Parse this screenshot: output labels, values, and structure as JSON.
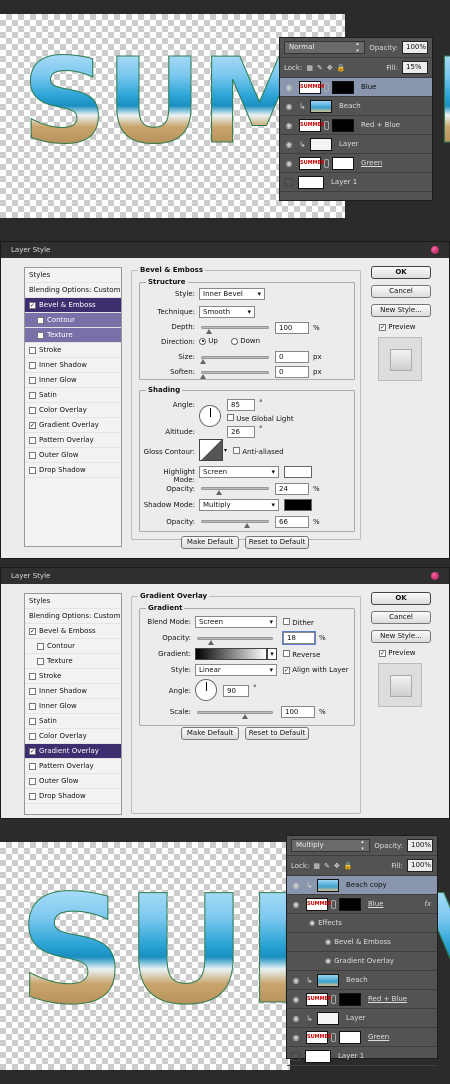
{
  "canvas1": {
    "word": "SUMME"
  },
  "layers1": {
    "blend_mode": "Normal",
    "opacity_label": "Opacity:",
    "opacity_value": "100%",
    "lock_label": "Lock:",
    "fill_label": "Fill:",
    "fill_value": "15%",
    "rows": [
      {
        "name": "Blue",
        "thumb": "SUMMER"
      },
      {
        "name": "Beach"
      },
      {
        "name": "Red + Blue",
        "thumb": "SUMMER"
      },
      {
        "name": "Layer"
      },
      {
        "name": "Green",
        "thumb": "SUMMER"
      },
      {
        "name": "Layer 1"
      }
    ]
  },
  "dialog1": {
    "title": "Layer Style",
    "styles_header": "Styles",
    "blending_options": "Blending Options: Custom",
    "style_items": [
      "Bevel & Emboss",
      "Contour",
      "Texture",
      "Stroke",
      "Inner Shadow",
      "Inner Glow",
      "Satin",
      "Color Overlay",
      "Gradient Overlay",
      "Pattern Overlay",
      "Outer Glow",
      "Drop Shadow"
    ],
    "section_title": "Bevel & Emboss",
    "structure": "Structure",
    "style_label": "Style:",
    "style_value": "Inner Bevel",
    "technique_label": "Technique:",
    "technique_value": "Smooth",
    "depth_label": "Depth:",
    "depth_value": "100",
    "pct": "%",
    "direction_label": "Direction:",
    "up": "Up",
    "down": "Down",
    "size_label": "Size:",
    "size_value": "0",
    "px": "px",
    "soften_label": "Soften:",
    "soften_value": "0",
    "shading": "Shading",
    "angle_label": "Angle:",
    "angle_value": "85",
    "deg": "°",
    "use_global_light": "Use Global Light",
    "altitude_label": "Altitude:",
    "altitude_value": "26",
    "gloss_label": "Gloss Contour:",
    "anti_aliased": "Anti-aliased",
    "highlight_label": "Highlight Mode:",
    "highlight_value": "Screen",
    "opacity_label": "Opacity:",
    "opacity1_value": "24",
    "shadow_label": "Shadow Mode:",
    "shadow_value": "Multiply",
    "opacity2_value": "66",
    "make_default": "Make Default",
    "reset_default": "Reset to Default",
    "ok": "OK",
    "cancel": "Cancel",
    "new_style": "New Style...",
    "preview": "Preview"
  },
  "dialog2": {
    "title": "Layer Style",
    "section_title": "Gradient Overlay",
    "gradient": "Gradient",
    "blend_label": "Blend Mode:",
    "blend_value": "Screen",
    "dither": "Dither",
    "opacity_label": "Opacity:",
    "opacity_value": "18",
    "gradient_label": "Gradient:",
    "reverse": "Reverse",
    "style_label": "Style:",
    "style_value": "Linear",
    "align": "Align with Layer",
    "angle_label": "Angle:",
    "angle_value": "90",
    "scale_label": "Scale:",
    "scale_value": "100"
  },
  "canvas2": {
    "word": "SUMM"
  },
  "layers2": {
    "blend_mode": "Multiply",
    "opacity_value": "100%",
    "fill_value": "100%",
    "rows": [
      {
        "name": "Beach copy"
      },
      {
        "name": "Blue",
        "fx": "fx",
        "thumb": "SUMMER"
      },
      {
        "name": "Effects"
      },
      {
        "name": "Bevel & Emboss"
      },
      {
        "name": "Gradient Overlay"
      },
      {
        "name": "Beach"
      },
      {
        "name": "Red + Blue",
        "thumb": "SUMMER"
      },
      {
        "name": "Layer"
      },
      {
        "name": "Green",
        "thumb": "SUMMER"
      },
      {
        "name": "Layer 1"
      }
    ]
  }
}
